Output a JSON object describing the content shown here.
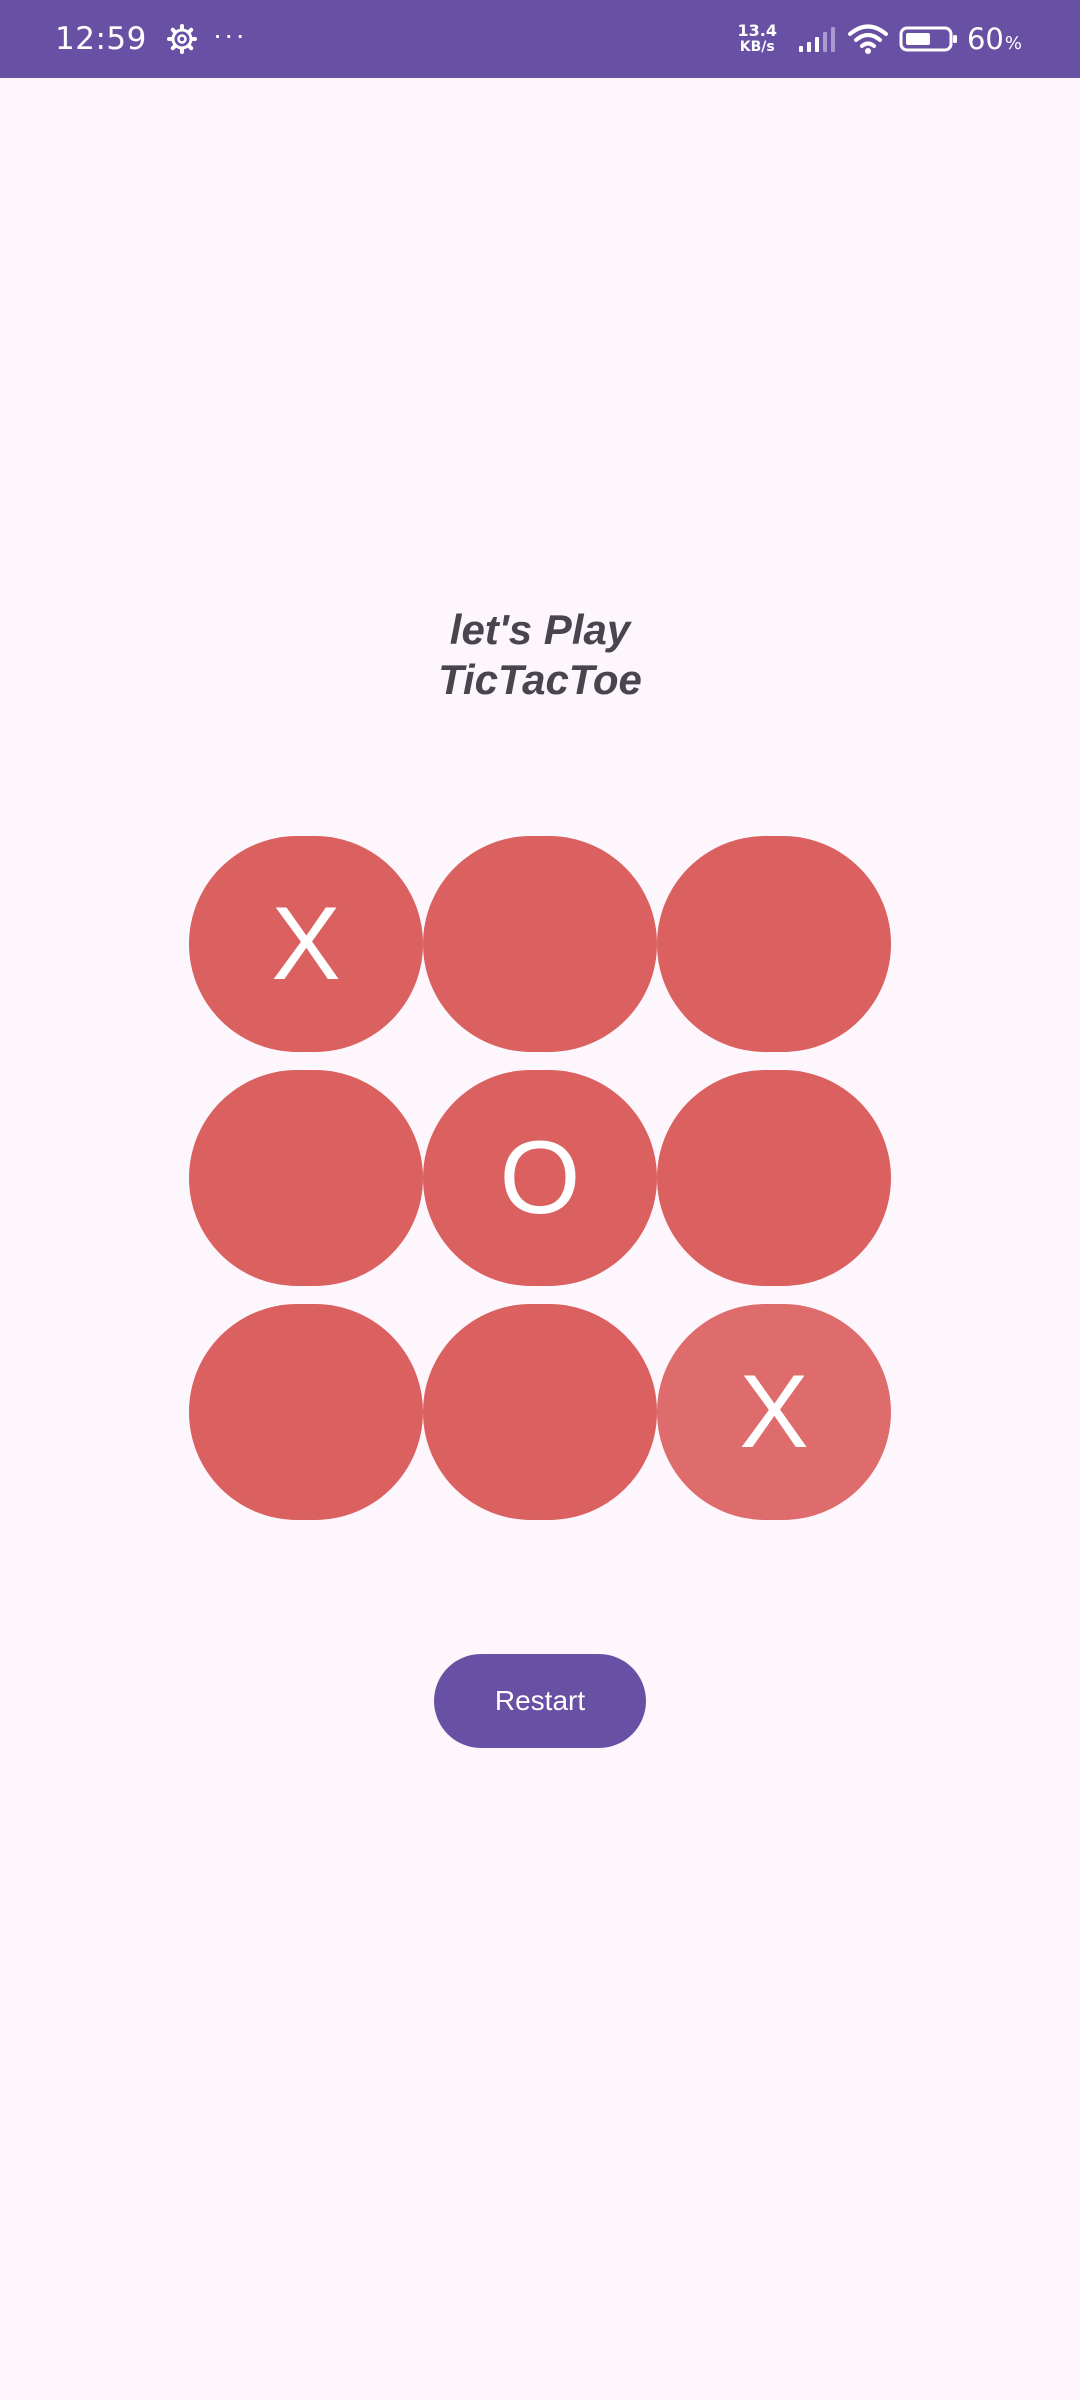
{
  "status_bar": {
    "time": "12:59",
    "more": "···",
    "network_speed_value": "13.4",
    "network_speed_unit": "KB/s",
    "battery_percent": "60",
    "battery_symbol": "%",
    "battery_level": 0.6,
    "icons": [
      "settings-gear-icon",
      "more-dots-icon",
      "signal-icon",
      "wifi-icon",
      "battery-icon"
    ]
  },
  "title": {
    "line1": "let's Play",
    "line2": "TicTacToe"
  },
  "board": {
    "cells": [
      "X",
      "",
      "",
      "",
      "O",
      "",
      "",
      "",
      "X"
    ]
  },
  "restart_label": "Restart",
  "colors": {
    "status_bar": "#6850a4",
    "background": "#fdf7fd",
    "cell": "#da6160",
    "cell_highlight": "#de6c6c",
    "button": "#6850a4",
    "title_text": "#49454f"
  }
}
